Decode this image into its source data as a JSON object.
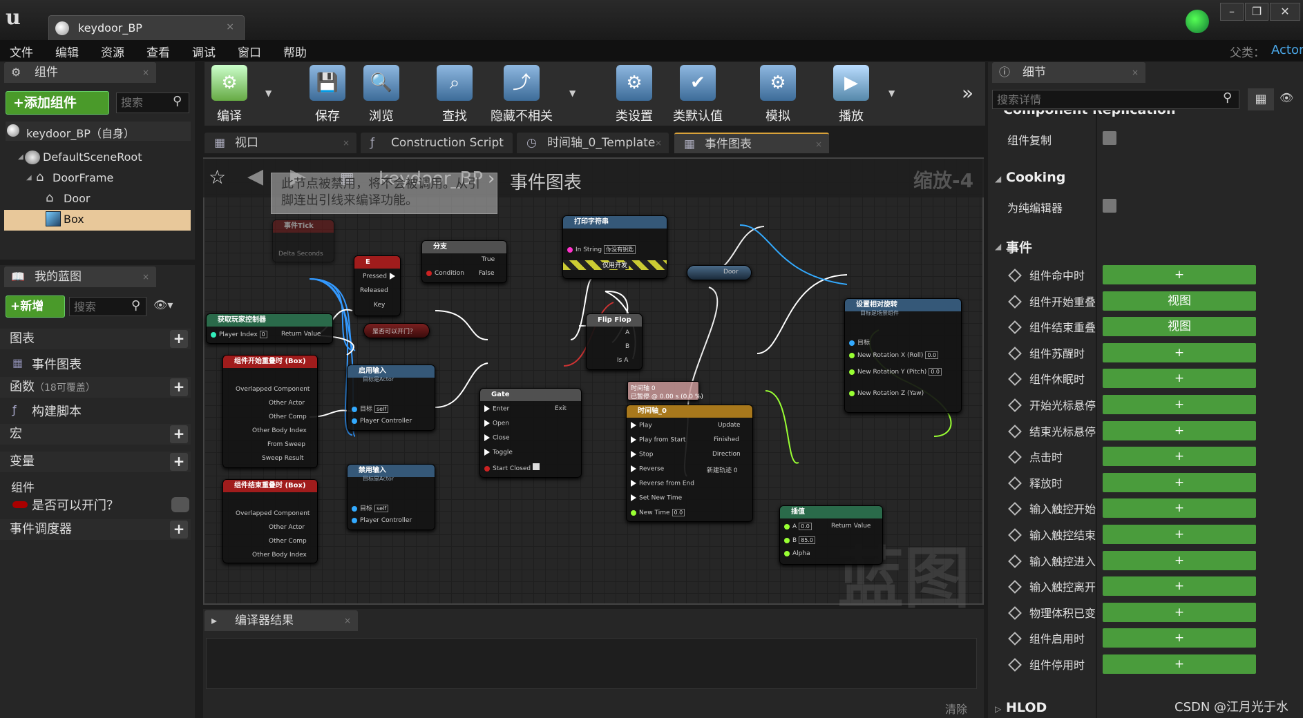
{
  "window": {
    "tab_title": "keydoor_BP",
    "parent_label": "父类：",
    "parent_value": "Actor"
  },
  "menu": [
    "文件",
    "编辑",
    "资源",
    "查看",
    "调试",
    "窗口",
    "帮助"
  ],
  "components": {
    "tab": "组件",
    "add_button": "+添加组件",
    "search_placeholder": "搜索",
    "self": "keydoor_BP（自身）",
    "tree": [
      "DefaultSceneRoot",
      "DoorFrame",
      "Door",
      "Box"
    ]
  },
  "mybp": {
    "tab": "我的蓝图",
    "new_button": "+新增",
    "search_placeholder": "搜索",
    "graphs": "图表",
    "event_graph": "事件图表",
    "functions": "函数",
    "functions_note": "（18可覆盖）",
    "construct": "构建脚本",
    "macros": "宏",
    "variables": "变量",
    "components": "组件",
    "var_door": "是否可以开门？",
    "dispatchers": "事件调度器"
  },
  "toolbar": [
    "编译",
    "保存",
    "浏览",
    "查找",
    "隐藏不相关",
    "类设置",
    "类默认值",
    "模拟",
    "播放"
  ],
  "graph_tabs": [
    "视口",
    "Construction Script",
    "时间轴_0_Template",
    "事件图表"
  ],
  "graph": {
    "breadcrumb_bp": "keydoor_BP",
    "breadcrumb_graph": "事件图表",
    "zoom": "缩放-4",
    "tooltip": "此节点被禁用，将不会被调用。从引脚连出引线来编译功能。",
    "watermark": "蓝图"
  },
  "nodes": {
    "tick": {
      "title": "事件Tick",
      "pin": "Delta Seconds"
    },
    "e": {
      "title": "E",
      "pins": [
        "Pressed",
        "Released",
        "Key"
      ]
    },
    "branch": {
      "title": "分支",
      "pins": [
        "Condition",
        "True",
        "False"
      ]
    },
    "print": {
      "title": "打印字符串",
      "pin": "In String",
      "value": "你没有钥匙",
      "dev": "仅用开发"
    },
    "door": {
      "title": "Door"
    },
    "getpc": {
      "title": "获取玩家控制器",
      "pins": [
        "Player Index",
        "Return Value"
      ],
      "value": "0"
    },
    "canopen": {
      "title": "是否可以开门？"
    },
    "flipflop": {
      "title": "Flip Flop",
      "pins": [
        "A",
        "B",
        "Is A"
      ]
    },
    "begin": {
      "title": "组件开始重叠时 (Box)",
      "pins": [
        "Overlapped Component",
        "Other Actor",
        "Other Comp",
        "Other Body Index",
        "From Sweep",
        "Sweep Result"
      ]
    },
    "enable": {
      "title": "启用输入",
      "sub": "目标是Actor",
      "pins": [
        "目标",
        "Player Controller"
      ],
      "self": "self"
    },
    "gate": {
      "title": "Gate",
      "pins": [
        "Enter",
        "Open",
        "Close",
        "Toggle",
        "Start Closed",
        "Exit"
      ]
    },
    "timeline": {
      "title": "时间轴_0",
      "tip1": "时间轴 0",
      "tip2": "已暂停 @ 0.00 s (0.0 %)",
      "pins": [
        "Play",
        "Play from Start",
        "Stop",
        "Reverse",
        "Reverse from End",
        "Set New Time",
        "New Time",
        "Update",
        "Finished",
        "Direction",
        "新建轨迹 0"
      ],
      "value": "0.0"
    },
    "setrot": {
      "title": "设置相对旋转",
      "sub": "目标是场景组件",
      "pins": [
        "目标",
        "New Rotation X (Roll)",
        "New Rotation Y (Pitch)",
        "New Rotation Z (Yaw)"
      ],
      "values": [
        "0.0",
        "0.0"
      ]
    },
    "end": {
      "title": "组件结束重叠时 (Box)",
      "pins": [
        "Overlapped Component",
        "Other Actor",
        "Other Comp",
        "Other Body Index"
      ]
    },
    "disable": {
      "title": "禁用输入",
      "sub": "目标是Actor",
      "pins": [
        "目标",
        "Player Controller"
      ],
      "self": "self"
    },
    "lerp": {
      "title": "插值",
      "pins": [
        "A",
        "B",
        "Alpha",
        "Return Value"
      ],
      "values": [
        "0.0",
        "85.0"
      ]
    }
  },
  "compiler": {
    "tab": "编译器结果",
    "clear": "清除"
  },
  "details": {
    "tab": "细节",
    "search_placeholder": "搜索详情",
    "cut_heading": "Component Replication",
    "rep_label": "组件复制",
    "cooking": "Cooking",
    "editor_only": "为纯编辑器",
    "events": "事件",
    "event_rows": [
      {
        "label": "组件命中时",
        "btn": "+"
      },
      {
        "label": "组件开始重叠",
        "btn": "视图"
      },
      {
        "label": "组件结束重叠",
        "btn": "视图"
      },
      {
        "label": "组件苏醒时",
        "btn": "+"
      },
      {
        "label": "组件休眠时",
        "btn": "+"
      },
      {
        "label": "开始光标悬停",
        "btn": "+"
      },
      {
        "label": "结束光标悬停",
        "btn": "+"
      },
      {
        "label": "点击时",
        "btn": "+"
      },
      {
        "label": "释放时",
        "btn": "+"
      },
      {
        "label": "输入触控开始",
        "btn": "+"
      },
      {
        "label": "输入触控结束",
        "btn": "+"
      },
      {
        "label": "输入触控进入",
        "btn": "+"
      },
      {
        "label": "输入触控离开",
        "btn": "+"
      },
      {
        "label": "物理体积已变",
        "btn": "+"
      },
      {
        "label": "组件启用时",
        "btn": "+"
      },
      {
        "label": "组件停用时",
        "btn": "+"
      }
    ],
    "hlod": "HLOD"
  },
  "watermark": "CSDN @江月光于水"
}
